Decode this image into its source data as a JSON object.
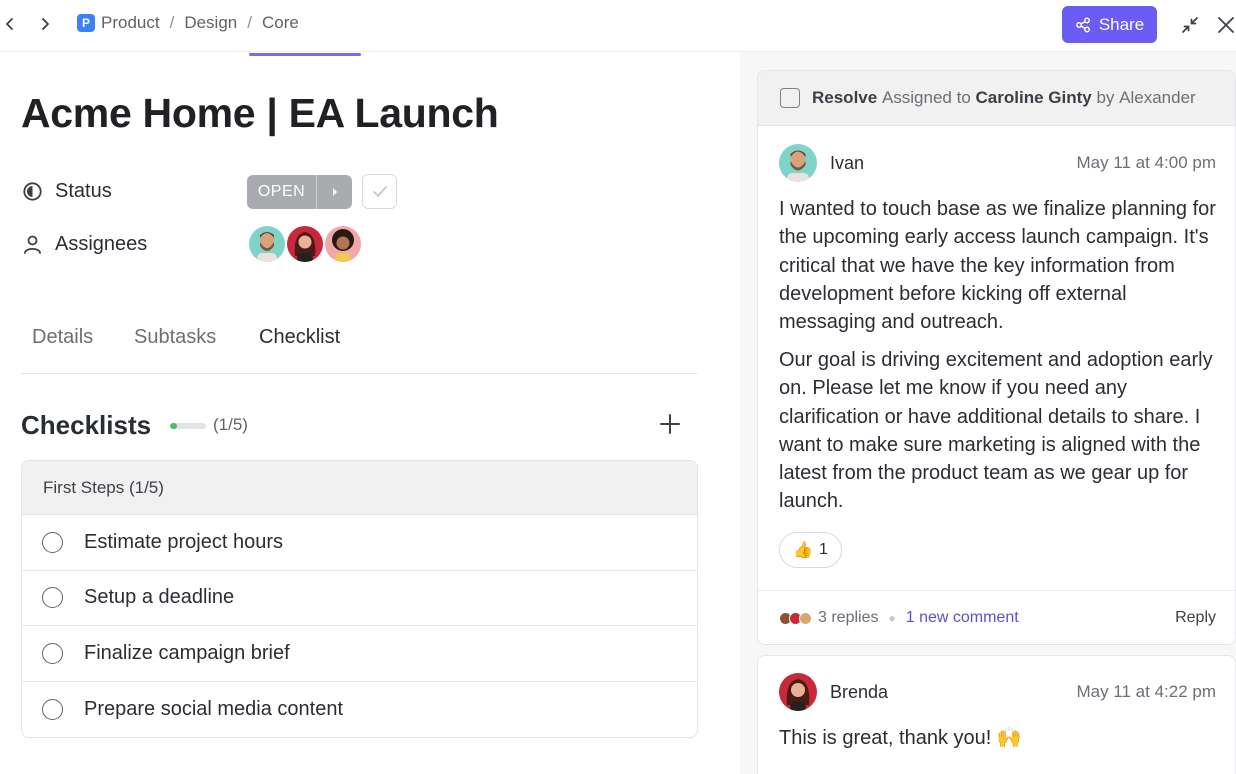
{
  "breadcrumb": {
    "space_initial": "P",
    "items": [
      "Product",
      "Design",
      "Core"
    ],
    "separator": "/"
  },
  "toolbar": {
    "share_label": "Share"
  },
  "task": {
    "title": "Acme Home | EA Launch",
    "status_label": "Status",
    "status_value": "OPEN",
    "assignees_label": "Assignees"
  },
  "tabs": [
    {
      "label": "Details",
      "active": false
    },
    {
      "label": "Subtasks",
      "active": false
    },
    {
      "label": "Checklist",
      "active": true
    }
  ],
  "checklists": {
    "heading": "Checklists",
    "progress_text": "(1/5)",
    "progress_fraction": 0.2,
    "groups": [
      {
        "title": "First Steps (1/5)",
        "items": [
          "Estimate project hours",
          "Setup a deadline",
          "Finalize campaign brief",
          "Prepare social media content"
        ]
      }
    ]
  },
  "thread": {
    "resolve_label": "Resolve",
    "assigned_prefix": "Assigned to",
    "assignee": "Caroline Ginty",
    "by_prefix": "by",
    "assigner": "Alexander",
    "comments": [
      {
        "author": "Ivan",
        "time": "May 11 at 4:00 pm",
        "paragraphs": [
          "I wanted to touch base as we finalize planning for the upcoming early access launch campaign. It's critical that we have the key information from development before kicking off external messaging and outreach.",
          "Our goal is driving excitement and adoption early on. Please let me know if you need any clarification or have additional details to share. I want to make sure marketing is aligned with the latest from the product team as we gear up for launch."
        ],
        "reaction_emoji": "👍",
        "reaction_count": "1",
        "replies": "3 replies",
        "new_comment": "1 new comment",
        "reply_label": "Reply"
      },
      {
        "author": "Brenda",
        "time": "May 11 at 4:22 pm",
        "text": "This is great, thank you! 🙌"
      }
    ]
  },
  "colors": {
    "accent": "#6a5cf5",
    "tab_underline": "#7b68ee",
    "progress": "#46c25d",
    "status_gray": "#a9abaf",
    "link": "#5b4fd6"
  }
}
